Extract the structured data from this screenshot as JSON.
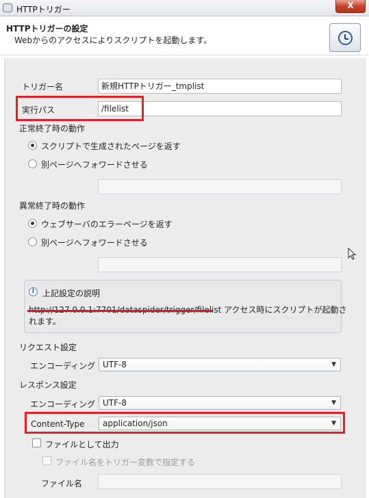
{
  "window": {
    "title": "HTTPトリガー",
    "close_label": "X"
  },
  "header": {
    "title": "HTTPトリガーの設定",
    "description": "Webからのアクセスによりスクリプトを起動します。",
    "icon": "clock-icon"
  },
  "form": {
    "trigger_name": {
      "label": "トリガー名",
      "value": "新規HTTPトリガー_tmplist"
    },
    "exec_path": {
      "label": "実行パス",
      "value": "/filelist"
    },
    "normal_end": {
      "label": "正常終了時の動作",
      "options": [
        "スクリプトで生成されたページを返す",
        "別ページへフォワードさせる"
      ],
      "selected": "スクリプトで生成されたページを返す",
      "forward_value": ""
    },
    "abnormal_end": {
      "label": "異常終了時の動作",
      "options": [
        "ウェブサーバのエラーページを返す",
        "別ページへフォワードさせる"
      ],
      "selected": "ウェブサーバのエラーページを返す",
      "forward_value": ""
    },
    "info": {
      "title": "上記設定の説明",
      "url_prefix": "http://",
      "url_host": "127.0.0.1:7701",
      "url_path": "/dataspider/trigger/filelist",
      "text_suffix": " アクセス時にスクリプトが起動さ",
      "text_line2": "れます。"
    },
    "request": {
      "section_label": "リクエスト設定",
      "encoding_label": "エンコーディング",
      "encoding_value": "UTF-8"
    },
    "response": {
      "section_label": "レスポンス設定",
      "encoding_label": "エンコーディング",
      "encoding_value": "UTF-8",
      "content_type_label": "Content-Type",
      "content_type_value": "application/json",
      "output_as_file_label": "ファイルとして出力",
      "output_as_file_checked": false,
      "filename_from_var_label": "ファイル名をトリガー変数で指定する",
      "filename_from_var_checked": false,
      "filename_label": "ファイル名",
      "filename_value": ""
    }
  },
  "highlight_color": "#e31e24"
}
